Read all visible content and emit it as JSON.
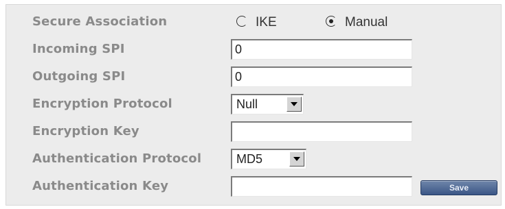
{
  "form": {
    "secure_association": {
      "label": "Secure Association",
      "options": [
        {
          "label": "IKE",
          "checked": false
        },
        {
          "label": "Manual",
          "checked": true
        }
      ]
    },
    "incoming_spi": {
      "label": "Incoming SPI",
      "value": "0"
    },
    "outgoing_spi": {
      "label": "Outgoing SPI",
      "value": "0"
    },
    "encryption_protocol": {
      "label": "Encryption Protocol",
      "selected": "Null"
    },
    "encryption_key": {
      "label": "Encryption Key",
      "value": ""
    },
    "authentication_protocol": {
      "label": "Authentication Protocol",
      "selected": "MD5"
    },
    "authentication_key": {
      "label": "Authentication Key",
      "value": ""
    },
    "save_label": "Save"
  },
  "icons": {
    "dropdown": "chevron-down-icon",
    "radio_checked": "radio-checked-icon",
    "radio_unchecked": "radio-unchecked-icon"
  },
  "colors": {
    "panel_bg": "#ececec",
    "label_text": "#8a8a8a",
    "save_button": "#3b5686"
  }
}
